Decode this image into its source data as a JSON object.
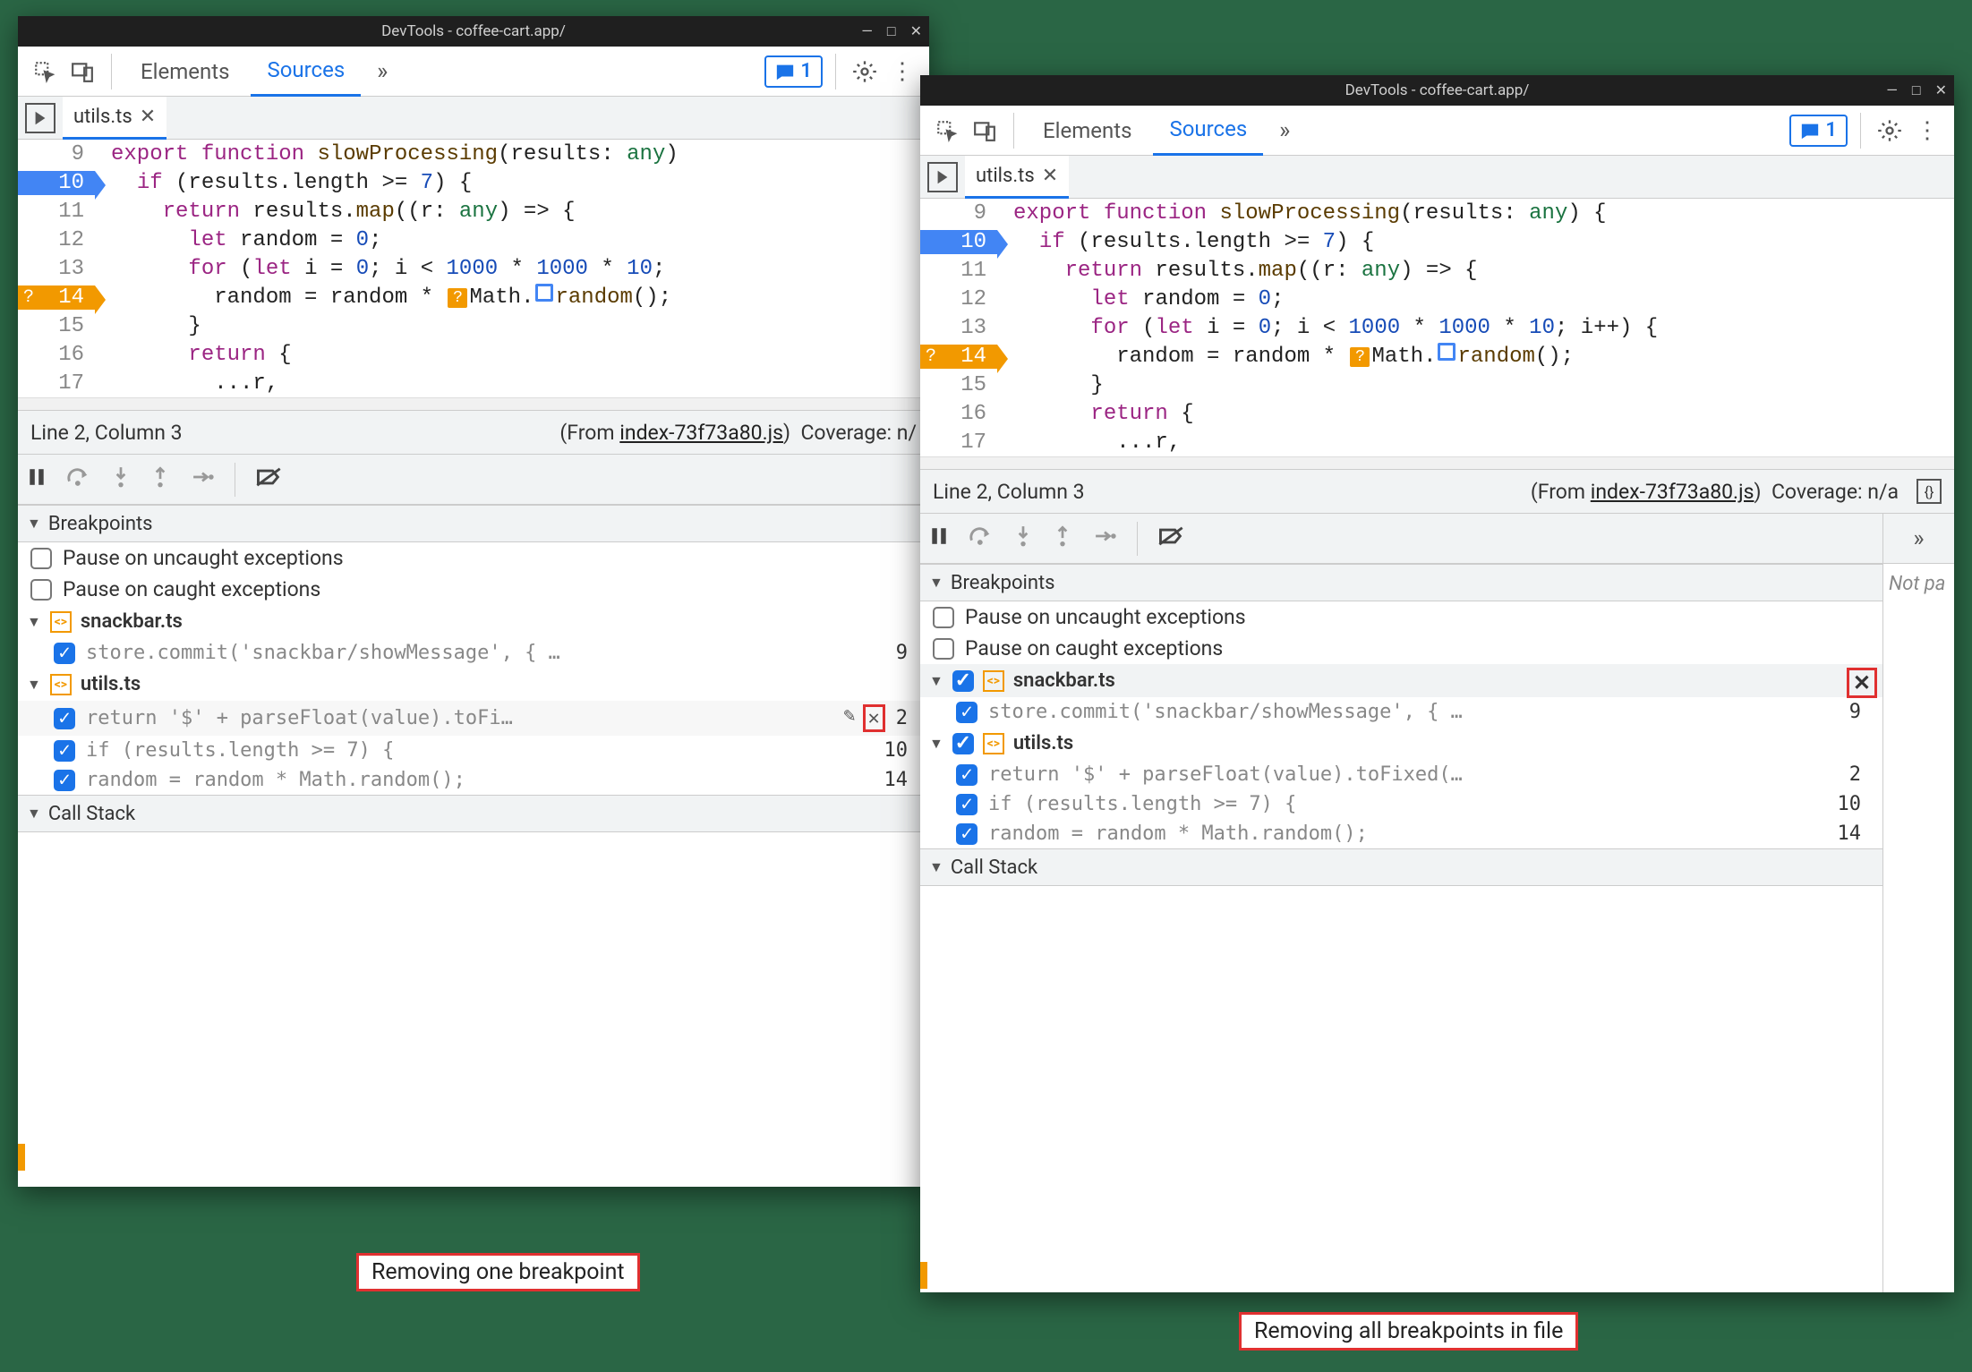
{
  "captions": {
    "left": "Removing one breakpoint",
    "right": "Removing all breakpoints in file"
  },
  "win1": {
    "title": "DevTools - coffee-cart.app/",
    "tabs": {
      "elements": "Elements",
      "sources": "Sources"
    },
    "issues_count": "1",
    "file_tab": "utils.ts",
    "status": {
      "pos": "Line 2, Column 3",
      "from_prefix": "(From ",
      "from_link": "index-73f73a80.js",
      "from_suffix": ")",
      "coverage": "Coverage: n/"
    },
    "sections": {
      "breakpoints": "Breakpoints",
      "callstack": "Call Stack"
    },
    "pause_uncaught": "Pause on uncaught exceptions",
    "pause_caught": "Pause on caught exceptions",
    "groups": [
      {
        "file": "snackbar.ts",
        "items": [
          {
            "code": "store.commit('snackbar/showMessage', { …",
            "line": "9"
          }
        ]
      },
      {
        "file": "utils.ts",
        "items": [
          {
            "code": "return '$' + parseFloat(value).toFi…",
            "line": "2",
            "hover": true
          },
          {
            "code": "if (results.length >= 7) {",
            "line": "10"
          },
          {
            "code": "random = random * Math.random();",
            "line": "14"
          }
        ]
      }
    ],
    "code_lines": [
      {
        "n": "9",
        "bp": "",
        "html": "<span class='kw'>export</span> <span class='kw'>function</span> <span class='fn'>slowProcessing</span>(<span>results</span>: <span class='ty'>any</span>)"
      },
      {
        "n": "10",
        "bp": "blue",
        "html": "  <span class='kw'>if</span> (results.length >= <span class='nm'>7</span>) {"
      },
      {
        "n": "11",
        "bp": "",
        "html": "    <span class='kw'>return</span> results.<span class='fn'>map</span>((<span>r</span>: <span class='ty'>any</span>) => {"
      },
      {
        "n": "12",
        "bp": "",
        "html": "      <span class='kw'>let</span> random = <span class='nm'>0</span>;"
      },
      {
        "n": "13",
        "bp": "",
        "html": "      <span class='kw'>for</span> (<span class='kw'>let</span> i = <span class='nm'>0</span>; i < <span class='nm'>1000</span> * <span class='nm'>1000</span> * <span class='nm'>10</span>;"
      },
      {
        "n": "14",
        "bp": "orange",
        "html": "        random = random * <span class='inline-bp orange'>?</span>Math.<span class='inline-bp blue-outline'></span><span class='fn'>random</span>();"
      },
      {
        "n": "15",
        "bp": "",
        "html": "      }"
      },
      {
        "n": "16",
        "bp": "",
        "html": "      <span class='kw'>return</span> {"
      },
      {
        "n": "17",
        "bp": "",
        "html": "        ...r,"
      }
    ]
  },
  "win2": {
    "title": "DevTools - coffee-cart.app/",
    "tabs": {
      "elements": "Elements",
      "sources": "Sources"
    },
    "issues_count": "1",
    "file_tab": "utils.ts",
    "status": {
      "pos": "Line 2, Column 3",
      "from_prefix": "(From ",
      "from_link": "index-73f73a80.js",
      "from_suffix": ")",
      "coverage": "Coverage: n/a"
    },
    "side_text": "Not pa",
    "sections": {
      "breakpoints": "Breakpoints",
      "callstack": "Call Stack"
    },
    "pause_uncaught": "Pause on uncaught exceptions",
    "pause_caught": "Pause on caught exceptions",
    "groups": [
      {
        "file": "snackbar.ts",
        "hover": true,
        "items": [
          {
            "code": "store.commit('snackbar/showMessage', { …",
            "line": "9"
          }
        ]
      },
      {
        "file": "utils.ts",
        "items": [
          {
            "code": "return '$' + parseFloat(value).toFixed(…",
            "line": "2"
          },
          {
            "code": "if (results.length >= 7) {",
            "line": "10"
          },
          {
            "code": "random = random * Math.random();",
            "line": "14"
          }
        ]
      }
    ],
    "code_lines": [
      {
        "n": "9",
        "bp": "",
        "html": "<span class='kw'>export</span> <span class='kw'>function</span> <span class='fn'>slowProcessing</span>(<span>results</span>: <span class='ty'>any</span>) {"
      },
      {
        "n": "10",
        "bp": "blue",
        "html": "  <span class='kw'>if</span> (results.length >= <span class='nm'>7</span>) {"
      },
      {
        "n": "11",
        "bp": "",
        "html": "    <span class='kw'>return</span> results.<span class='fn'>map</span>((<span>r</span>: <span class='ty'>any</span>) => {"
      },
      {
        "n": "12",
        "bp": "",
        "html": "      <span class='kw'>let</span> random = <span class='nm'>0</span>;"
      },
      {
        "n": "13",
        "bp": "",
        "html": "      <span class='kw'>for</span> (<span class='kw'>let</span> i = <span class='nm'>0</span>; i < <span class='nm'>1000</span> * <span class='nm'>1000</span> * <span class='nm'>10</span>; i++) {"
      },
      {
        "n": "14",
        "bp": "orange",
        "html": "        random = random * <span class='inline-bp orange'>?</span>Math.<span class='inline-bp blue-outline'></span><span class='fn'>random</span>();"
      },
      {
        "n": "15",
        "bp": "",
        "html": "      }"
      },
      {
        "n": "16",
        "bp": "",
        "html": "      <span class='kw'>return</span> {"
      },
      {
        "n": "17",
        "bp": "",
        "html": "        ...r,"
      }
    ]
  }
}
